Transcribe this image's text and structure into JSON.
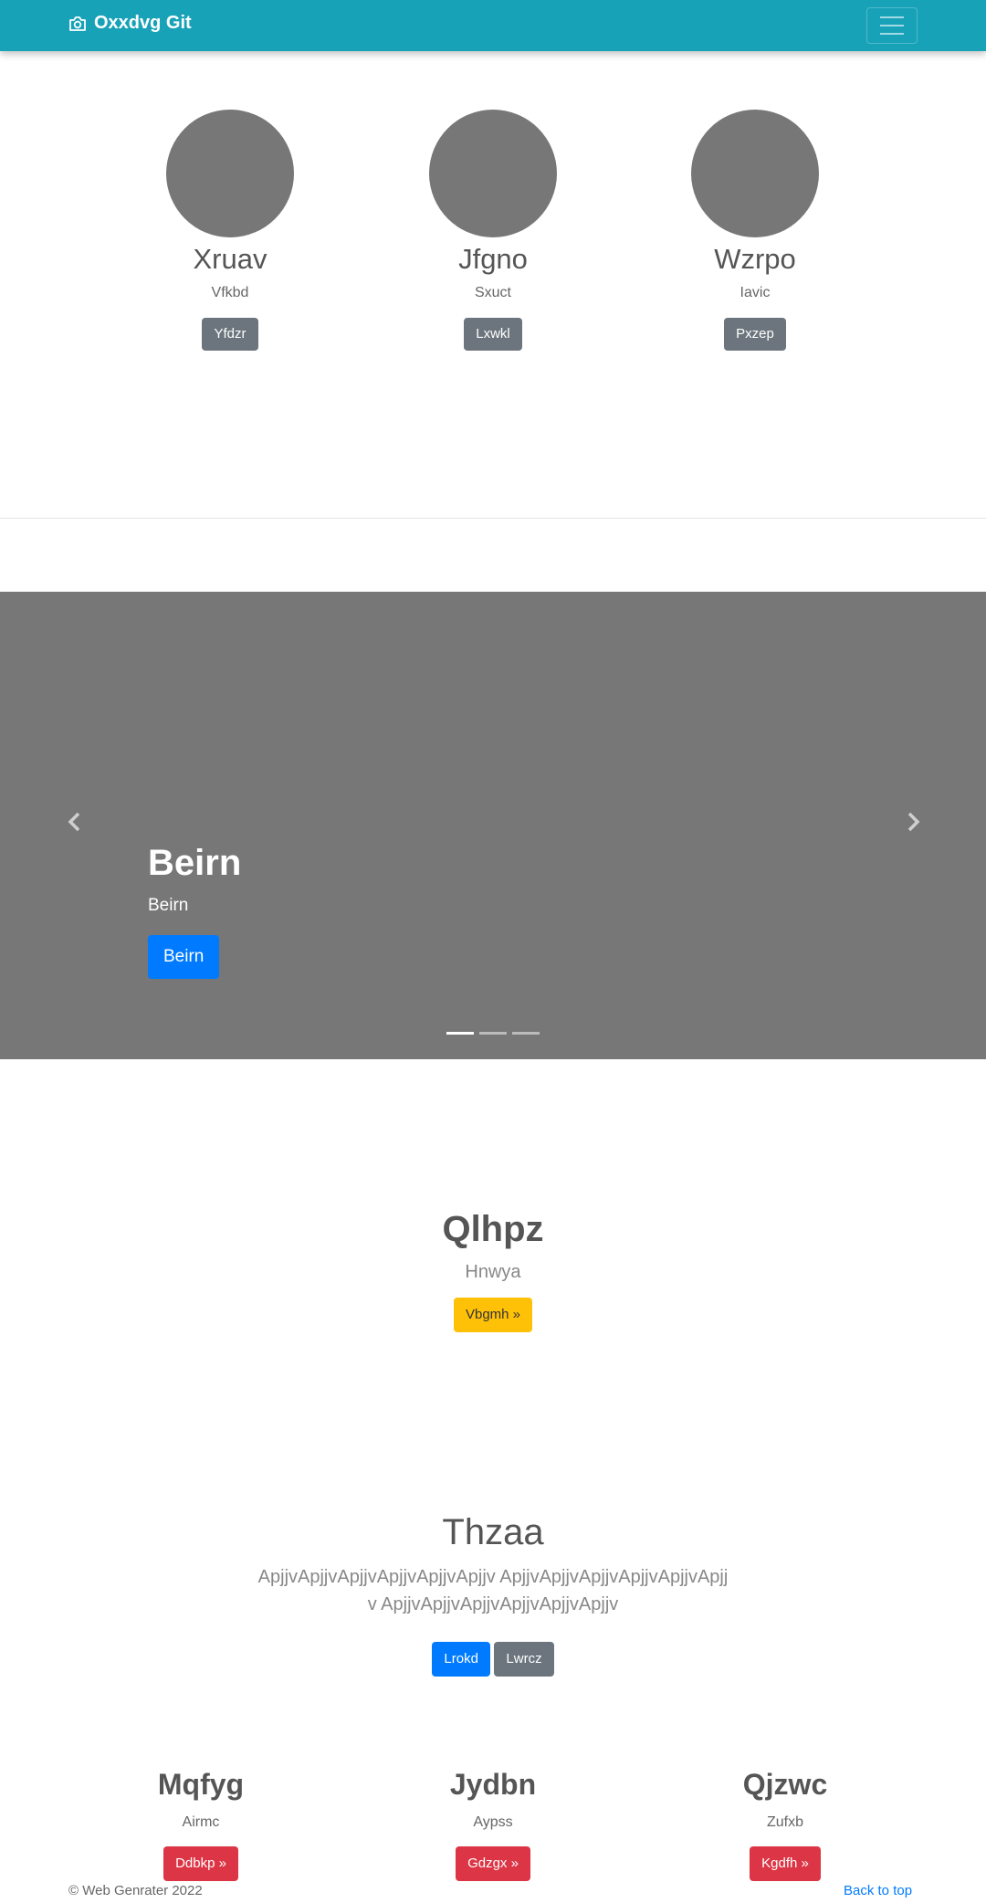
{
  "navbar": {
    "brand": "Oxxdvg Git",
    "brand_icon": "camera-icon",
    "toggler_icon": "menu-icon"
  },
  "profiles": [
    {
      "name": "Xruav",
      "subtitle": "Vfkbd",
      "button": "Yfdzr"
    },
    {
      "name": "Jfgno",
      "subtitle": "Sxuct",
      "button": "Lxwkl"
    },
    {
      "name": "Wzrpo",
      "subtitle": "Iavic",
      "button": "Pxzep"
    }
  ],
  "carousel": {
    "title": "Beirn",
    "text": "Beirn",
    "button": "Beirn",
    "slides": 3,
    "active": 0
  },
  "feature": {
    "title": "Qlhpz",
    "subtitle": "Hnwya",
    "button": "Vbgmh »"
  },
  "jumbotron": {
    "title": "Thzaa",
    "text": "ApjjvApjjvApjjvApjjvApjjvApjjv ApjjvApjjvApjjvApjjvApjjvApjjv ApjjvApjjvApjjvApjjvApjjvApjjv",
    "primary_button": "Lrokd",
    "secondary_button": "Lwrcz"
  },
  "columns": [
    {
      "title": "Mqfyg",
      "subtitle": "Airmc",
      "button": "Ddbkp »"
    },
    {
      "title": "Jydbn",
      "subtitle": "Aypss",
      "button": "Gdzgx »"
    },
    {
      "title": "Qjzwc",
      "subtitle": "Zufxb",
      "button": "Kgdfh »"
    }
  ],
  "footer": {
    "copyright": "© Web Genrater 2022",
    "back_to_top": "Back to top"
  },
  "colors": {
    "navbar": "#17a2b8",
    "placeholder": "#777777",
    "primary": "#007bff",
    "secondary": "#6c757d",
    "warning": "#ffc107",
    "danger": "#dc3545"
  }
}
